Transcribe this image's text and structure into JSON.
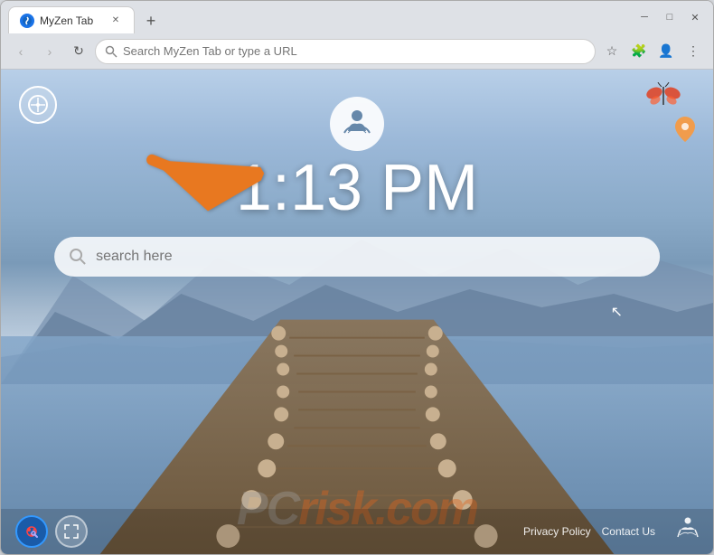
{
  "window": {
    "title": "MyZen Tab",
    "tab_label": "MyZen Tab",
    "favicon": "🧘"
  },
  "navbar": {
    "address_placeholder": "Search MyZen Tab or type a URL",
    "back_label": "‹",
    "forward_label": "›",
    "refresh_label": "↻"
  },
  "page": {
    "time": "1:13 PM",
    "search_placeholder": "search here",
    "meditation_icon": "🧘",
    "compass_icon": "✛",
    "mascot_icon": "🦋",
    "privacy_policy_label": "Privacy Policy",
    "contact_us_label": "Contact Us",
    "watermark_text": "PC",
    "watermark_text2": "risk.com"
  },
  "colors": {
    "accent_orange": "#e87820",
    "tab_bg": "#ffffff",
    "navbar_bg": "#dee1e6",
    "sky_top": "#b8cfe8",
    "water_mid": "#7a9ab8"
  }
}
